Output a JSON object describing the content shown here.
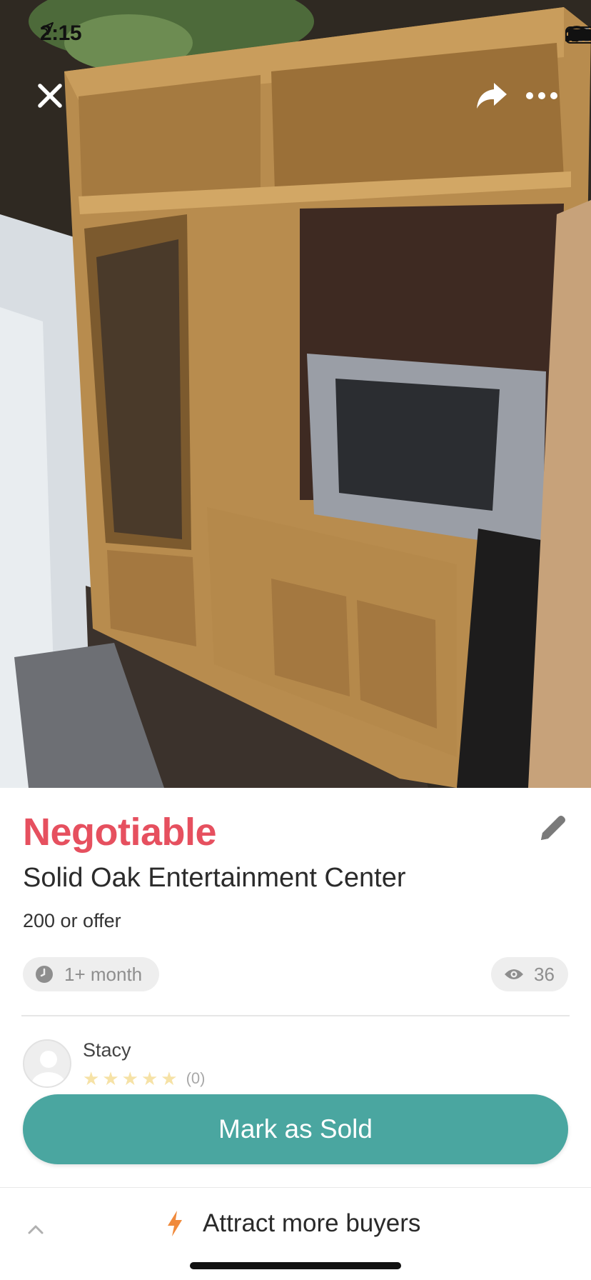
{
  "status_bar": {
    "time": "2:15"
  },
  "listing": {
    "price": "Negotiable",
    "title": "Solid Oak Entertainment Center",
    "description": "200 or offer",
    "posted_age": "1+ month",
    "view_count": "36"
  },
  "seller": {
    "name": "Stacy",
    "rating_count": "(0)",
    "stars": 5
  },
  "actions": {
    "primary": "Mark as Sold",
    "promote": "Attract more buyers"
  },
  "icons": {
    "close": "close-icon",
    "share": "share-icon",
    "more": "more-icon",
    "edit": "pencil-icon",
    "clock": "clock-icon",
    "views": "eye-icon",
    "promote": "lightning-icon",
    "expand": "chevron-up-icon"
  },
  "colors": {
    "price": "#e6505f",
    "primary_button": "#4aa6a0",
    "promote_icon": "#f08a3c"
  }
}
